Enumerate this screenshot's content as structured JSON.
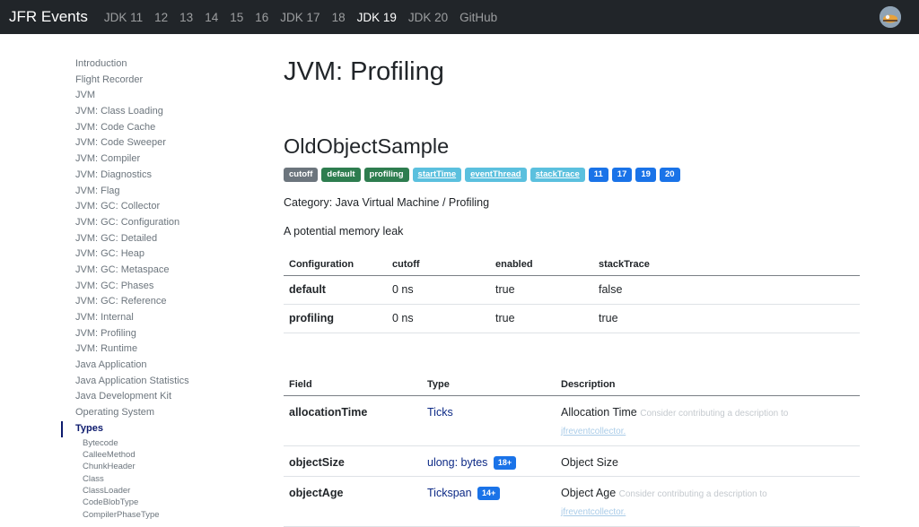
{
  "nav": {
    "brand": "JFR Events",
    "links": [
      "JDK 11",
      "12",
      "13",
      "14",
      "15",
      "16",
      "JDK 17",
      "18",
      "JDK 19",
      "JDK 20",
      "GitHub"
    ],
    "active": "JDK 19"
  },
  "sidebar": {
    "items": [
      "Introduction",
      "Flight Recorder",
      "JVM",
      "JVM: Class Loading",
      "JVM: Code Cache",
      "JVM: Code Sweeper",
      "JVM: Compiler",
      "JVM: Diagnostics",
      "JVM: Flag",
      "JVM: GC: Collector",
      "JVM: GC: Configuration",
      "JVM: GC: Detailed",
      "JVM: GC: Heap",
      "JVM: GC: Metaspace",
      "JVM: GC: Phases",
      "JVM: GC: Reference",
      "JVM: Internal",
      "JVM: Profiling",
      "JVM: Runtime",
      "Java Application",
      "Java Application Statistics",
      "Java Development Kit",
      "Operating System",
      "Types"
    ],
    "active": "Types",
    "sub_items": [
      "Bytecode",
      "CalleeMethod",
      "ChunkHeader",
      "Class",
      "ClassLoader",
      "CodeBlobType",
      "CompilerPhaseType"
    ]
  },
  "main": {
    "page_title": "JVM: Profiling",
    "event_title": "OldObjectSample",
    "badges": [
      {
        "label": "cutoff",
        "style": "secondary"
      },
      {
        "label": "default",
        "style": "success"
      },
      {
        "label": "profiling",
        "style": "success"
      },
      {
        "label": "startTime",
        "style": "info"
      },
      {
        "label": "eventThread",
        "style": "info"
      },
      {
        "label": "stackTrace",
        "style": "info"
      },
      {
        "label": "11",
        "style": "primary"
      },
      {
        "label": "17",
        "style": "primary"
      },
      {
        "label": "19",
        "style": "primary"
      },
      {
        "label": "20",
        "style": "primary"
      }
    ],
    "category": "Category: Java Virtual Machine / Profiling",
    "description": "A potential memory leak",
    "config_table": {
      "headers": [
        "Configuration",
        "cutoff",
        "enabled",
        "stackTrace"
      ],
      "rows": [
        [
          "default",
          "0 ns",
          "true",
          "false"
        ],
        [
          "profiling",
          "0 ns",
          "true",
          "true"
        ]
      ]
    },
    "field_table": {
      "headers": [
        "Field",
        "Type",
        "Description"
      ],
      "rows": [
        {
          "field": "allocationTime",
          "type": "Ticks",
          "badge": "",
          "desc": "Allocation Time",
          "note": "Consider contributing a description to",
          "link": "jfreventcollector."
        },
        {
          "field": "objectSize",
          "type": "ulong: bytes",
          "badge": "18+",
          "desc": "Object Size",
          "note": "",
          "link": ""
        },
        {
          "field": "objectAge",
          "type": "Tickspan",
          "badge": "14+",
          "desc": "Object Age",
          "note": "Consider contributing a description to",
          "link": "jfreventcollector."
        }
      ]
    }
  }
}
